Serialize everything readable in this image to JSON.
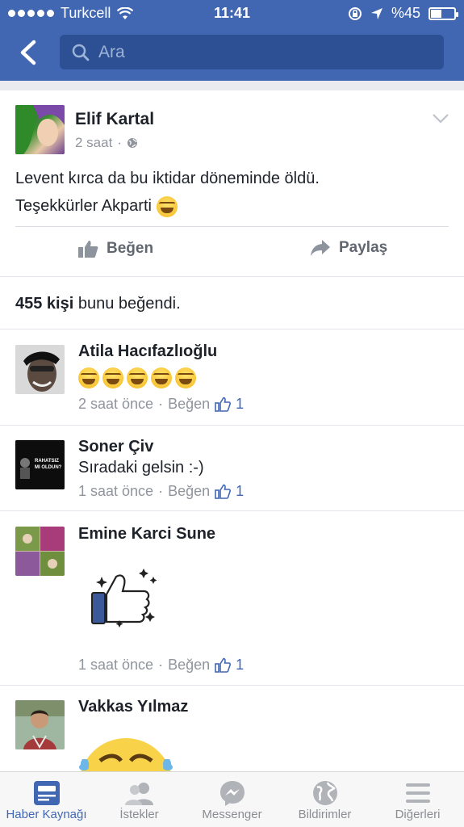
{
  "status_bar": {
    "carrier": "Turkcell",
    "time": "11:41",
    "battery_text": "%45",
    "battery_level": 0.45
  },
  "search": {
    "placeholder": "Ara"
  },
  "post": {
    "author": "Elif Kartal",
    "time": "2 saat",
    "text_line1": "Levent kırca da bu iktidar döneminde öldü.",
    "text_line2": "Teşekkürler Akparti",
    "like_label": "Beğen",
    "share_label": "Paylaş"
  },
  "likes": {
    "count": "455 kişi",
    "suffix": "bunu beğendi."
  },
  "comments": [
    {
      "name": "Atila Hacıfazlıoğlu",
      "text": "",
      "time": "2 saat önce",
      "like_label": "Beğen",
      "likes": "1",
      "emoji_count": 5
    },
    {
      "name": "Soner Çiv",
      "text": "Sıradaki gelsin :-)",
      "time": "1 saat önce",
      "like_label": "Beğen",
      "likes": "1",
      "avatar_text": "RAHATSIZ MI OLDUN?"
    },
    {
      "name": "Emine Karci Sune",
      "text": "",
      "time": "1 saat önce",
      "like_label": "Beğen",
      "likes": "1",
      "sticker": "thumbs-up-sparkle"
    },
    {
      "name": "Vakkas Yılmaz",
      "text": ""
    }
  ],
  "tabs": [
    {
      "label": "Haber Kaynağı",
      "icon": "news-feed-icon",
      "active": true
    },
    {
      "label": "İstekler",
      "icon": "friend-requests-icon"
    },
    {
      "label": "Messenger",
      "icon": "messenger-icon"
    },
    {
      "label": "Bildirimler",
      "icon": "globe-icon"
    },
    {
      "label": "Diğerleri",
      "icon": "menu-icon"
    }
  ],
  "colors": {
    "brand": "#4267b2",
    "search_bg": "#2d4f94",
    "muted": "#90949c"
  }
}
